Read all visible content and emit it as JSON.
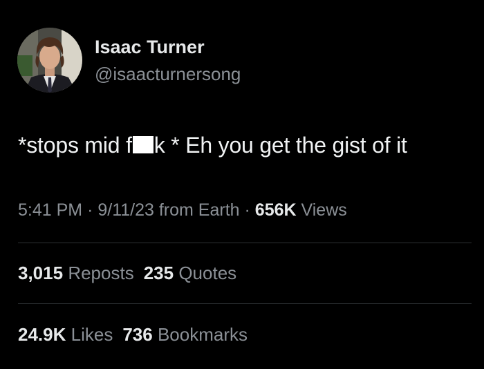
{
  "user": {
    "name": "Isaac Turner",
    "handle": "@isaacturnersong"
  },
  "tweet": {
    "text_before": "*stops mid f",
    "text_after": "k * Eh you get the gist of it"
  },
  "meta": {
    "time": "5:41 PM",
    "separator": "·",
    "date": "9/11/23",
    "source": "from Earth",
    "views_count": "656K",
    "views_label": "Views"
  },
  "stats": {
    "reposts_count": "3,015",
    "reposts_label": "Reposts",
    "quotes_count": "235",
    "quotes_label": "Quotes",
    "likes_count": "24.9K",
    "likes_label": "Likes",
    "bookmarks_count": "736",
    "bookmarks_label": "Bookmarks"
  },
  "colors": {
    "background": "#000000",
    "primary_text": "#e7e9ea",
    "secondary_text": "#8b9096",
    "divider": "#2f3336",
    "censor": "#ffffff"
  }
}
